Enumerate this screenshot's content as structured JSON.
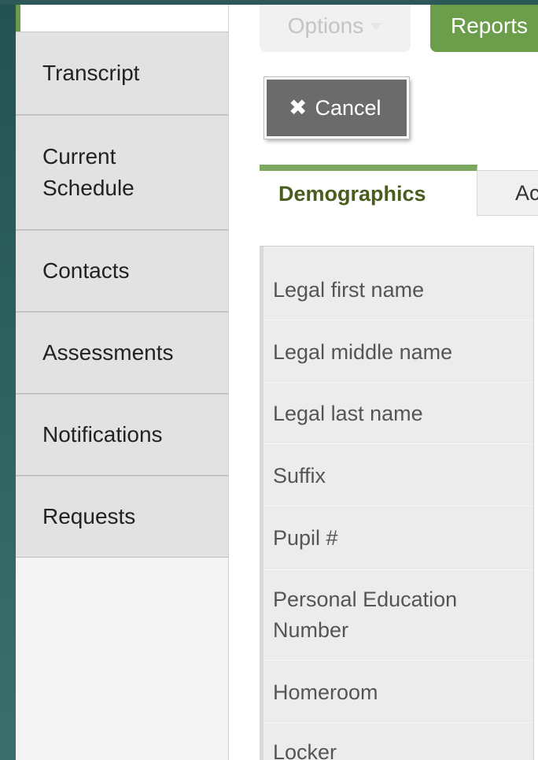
{
  "sidebar": {
    "items": [
      {
        "label": "Transcript"
      },
      {
        "label": "Current Schedule"
      },
      {
        "label": "Contacts"
      },
      {
        "label": "Assessments"
      },
      {
        "label": "Notifications"
      },
      {
        "label": "Requests"
      }
    ]
  },
  "toolbar": {
    "options_label": "Options",
    "reports_label": "Reports"
  },
  "cancel": {
    "label": "Cancel"
  },
  "tabs": [
    {
      "label": "Demographics",
      "active": true
    },
    {
      "label": "Ac",
      "active": false
    }
  ],
  "fields": [
    {
      "label": "Legal first name"
    },
    {
      "label": "Legal middle name"
    },
    {
      "label": "Legal last name"
    },
    {
      "label": "Suffix"
    },
    {
      "label": "Pupil #"
    },
    {
      "label": "Personal Education Number"
    },
    {
      "label": "Homeroom"
    },
    {
      "label": "Locker"
    }
  ],
  "colors": {
    "accent": "#6b9d4a",
    "tab_text": "#4a5d1f",
    "cancel_bg": "#6b6b6b",
    "background": "#2f5e5d"
  }
}
